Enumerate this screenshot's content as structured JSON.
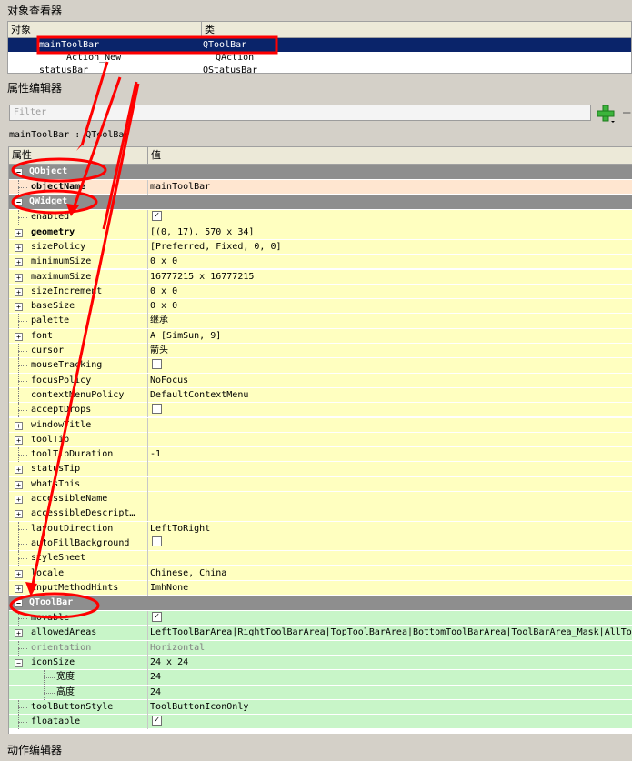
{
  "object_inspector": {
    "title": "对象查看器",
    "col_object": "对象",
    "col_class": "类",
    "rows": [
      {
        "object": "mainToolBar",
        "class": "QToolBar",
        "selected": true
      },
      {
        "object": "Action_New",
        "class": "QAction"
      },
      {
        "object": "statusBar",
        "class": "QStatusBar"
      }
    ]
  },
  "property_editor": {
    "title": "属性编辑器",
    "filter_placeholder": "Filter",
    "current_object": "mainToolBar : QToolBar",
    "col_property": "属性",
    "col_value": "值",
    "rows": [
      {
        "type": "group",
        "name": "QObject"
      },
      {
        "name": "objectName",
        "value": "mainToolBar",
        "bold": true,
        "color": "p"
      },
      {
        "type": "group",
        "name": "QWidget"
      },
      {
        "name": "enabled",
        "check": true,
        "color": "y"
      },
      {
        "name": "geometry",
        "value": "[(0, 17), 570 x 34]",
        "bold": true,
        "expand": true,
        "color": "y"
      },
      {
        "name": "sizePolicy",
        "value": "[Preferred, Fixed, 0, 0]",
        "expand": true,
        "color": "y"
      },
      {
        "name": "minimumSize",
        "value": "0 x 0",
        "expand": true,
        "color": "y"
      },
      {
        "name": "maximumSize",
        "value": "16777215 x 16777215",
        "expand": true,
        "color": "y"
      },
      {
        "name": "sizeIncrement",
        "value": "0 x 0",
        "expand": true,
        "color": "y"
      },
      {
        "name": "baseSize",
        "value": "0 x 0",
        "expand": true,
        "color": "y"
      },
      {
        "name": "palette",
        "value": "继承",
        "color": "y"
      },
      {
        "name": "font",
        "value": "A  [SimSun, 9]",
        "expand": true,
        "color": "y"
      },
      {
        "name": "cursor",
        "value": "箭头",
        "color": "y"
      },
      {
        "name": "mouseTracking",
        "check": false,
        "color": "y"
      },
      {
        "name": "focusPolicy",
        "value": "NoFocus",
        "color": "y"
      },
      {
        "name": "contextMenuPolicy",
        "value": "DefaultContextMenu",
        "color": "y"
      },
      {
        "name": "acceptDrops",
        "check": false,
        "color": "y"
      },
      {
        "name": "windowTitle",
        "value": "",
        "expand": true,
        "color": "y"
      },
      {
        "name": "toolTip",
        "value": "",
        "expand": true,
        "color": "y"
      },
      {
        "name": "toolTipDuration",
        "value": "-1",
        "color": "y"
      },
      {
        "name": "statusTip",
        "value": "",
        "expand": true,
        "color": "y"
      },
      {
        "name": "whatsThis",
        "value": "",
        "expand": true,
        "color": "y"
      },
      {
        "name": "accessibleName",
        "value": "",
        "expand": true,
        "color": "y"
      },
      {
        "name": "accessibleDescript…",
        "value": "",
        "expand": true,
        "color": "y"
      },
      {
        "name": "layoutDirection",
        "value": "LeftToRight",
        "color": "y"
      },
      {
        "name": "autoFillBackground",
        "check": false,
        "color": "y"
      },
      {
        "name": "styleSheet",
        "value": "",
        "color": "y"
      },
      {
        "name": "locale",
        "value": "Chinese, China",
        "expand": true,
        "color": "y"
      },
      {
        "name": "inputMethodHints",
        "value": "ImhNone",
        "expand": true,
        "color": "y"
      },
      {
        "type": "group",
        "name": "QToolBar"
      },
      {
        "name": "movable",
        "check": true,
        "color": "g"
      },
      {
        "name": "allowedAreas",
        "value": "LeftToolBarArea|RightToolBarArea|TopToolBarArea|BottomToolBarArea|ToolBarArea_Mask|AllToo",
        "expand": true,
        "color": "g"
      },
      {
        "name": "orientation",
        "value": "Horizontal",
        "gray": true,
        "color": "g"
      },
      {
        "name": "iconSize",
        "value": "24 x 24",
        "expand": true,
        "open": true,
        "color": "g"
      },
      {
        "name": "宽度",
        "value": "24",
        "child": true,
        "color": "g"
      },
      {
        "name": "高度",
        "value": "24",
        "child": true,
        "color": "g"
      },
      {
        "name": "toolButtonStyle",
        "value": "ToolButtonIconOnly",
        "color": "g"
      },
      {
        "name": "floatable",
        "check": true,
        "color": "g"
      }
    ]
  },
  "action_editor": {
    "title": "动作编辑器"
  },
  "colors": {
    "selection": "#0a246a",
    "annotation": "#ff0000",
    "group_header": "#8e8e8e",
    "qwidget_row": "#ffffc0",
    "qtoolbar_row": "#c8f5c8",
    "qobject_row": "#ffe6d0"
  }
}
